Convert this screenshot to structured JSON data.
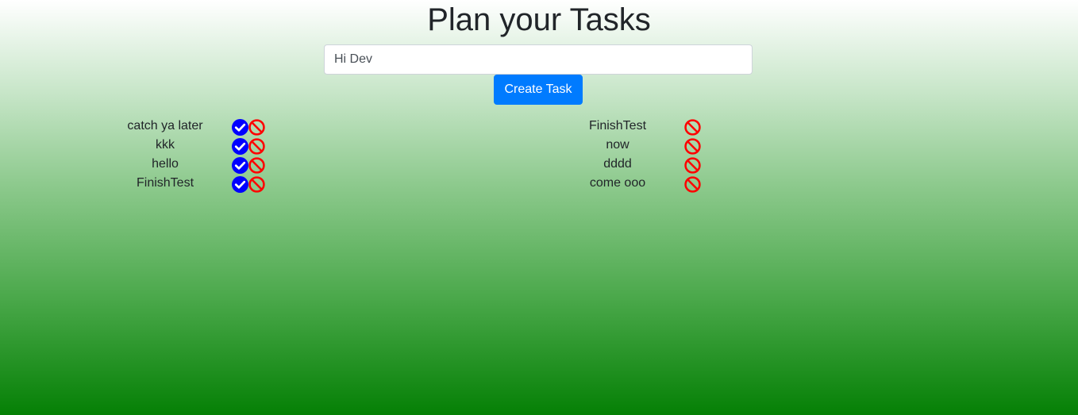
{
  "header": {
    "title": "Plan your Tasks"
  },
  "task_input": {
    "value": "Hi Dev",
    "placeholder": ""
  },
  "create_button": {
    "label": "Create Task"
  },
  "pending_tasks": [
    {
      "text": "catch ya later"
    },
    {
      "text": "kkk"
    },
    {
      "text": "hello"
    },
    {
      "text": "FinishTest"
    }
  ],
  "completed_tasks": [
    {
      "text": "FinishTest"
    },
    {
      "text": "now"
    },
    {
      "text": "dddd"
    },
    {
      "text": "come ooo"
    }
  ],
  "icons": {
    "complete": "check-circle-icon",
    "delete": "ban-icon"
  },
  "colors": {
    "complete_icon": "#0000ff",
    "delete_icon": "#ff0000",
    "button": "#007bff"
  }
}
